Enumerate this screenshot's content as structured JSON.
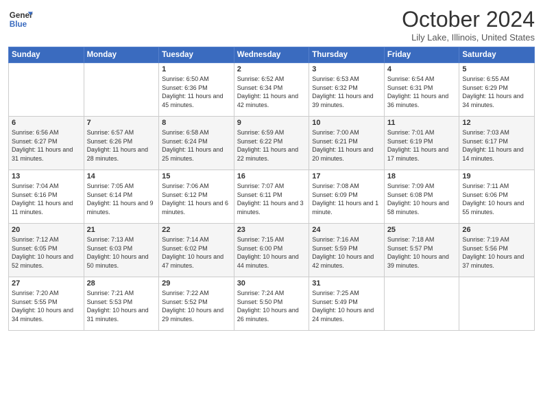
{
  "header": {
    "logo_line1": "General",
    "logo_line2": "Blue",
    "month_title": "October 2024",
    "location": "Lily Lake, Illinois, United States"
  },
  "days_of_week": [
    "Sunday",
    "Monday",
    "Tuesday",
    "Wednesday",
    "Thursday",
    "Friday",
    "Saturday"
  ],
  "weeks": [
    [
      {
        "day": "",
        "info": ""
      },
      {
        "day": "",
        "info": ""
      },
      {
        "day": "1",
        "info": "Sunrise: 6:50 AM\nSunset: 6:36 PM\nDaylight: 11 hours and 45 minutes."
      },
      {
        "day": "2",
        "info": "Sunrise: 6:52 AM\nSunset: 6:34 PM\nDaylight: 11 hours and 42 minutes."
      },
      {
        "day": "3",
        "info": "Sunrise: 6:53 AM\nSunset: 6:32 PM\nDaylight: 11 hours and 39 minutes."
      },
      {
        "day": "4",
        "info": "Sunrise: 6:54 AM\nSunset: 6:31 PM\nDaylight: 11 hours and 36 minutes."
      },
      {
        "day": "5",
        "info": "Sunrise: 6:55 AM\nSunset: 6:29 PM\nDaylight: 11 hours and 34 minutes."
      }
    ],
    [
      {
        "day": "6",
        "info": "Sunrise: 6:56 AM\nSunset: 6:27 PM\nDaylight: 11 hours and 31 minutes."
      },
      {
        "day": "7",
        "info": "Sunrise: 6:57 AM\nSunset: 6:26 PM\nDaylight: 11 hours and 28 minutes."
      },
      {
        "day": "8",
        "info": "Sunrise: 6:58 AM\nSunset: 6:24 PM\nDaylight: 11 hours and 25 minutes."
      },
      {
        "day": "9",
        "info": "Sunrise: 6:59 AM\nSunset: 6:22 PM\nDaylight: 11 hours and 22 minutes."
      },
      {
        "day": "10",
        "info": "Sunrise: 7:00 AM\nSunset: 6:21 PM\nDaylight: 11 hours and 20 minutes."
      },
      {
        "day": "11",
        "info": "Sunrise: 7:01 AM\nSunset: 6:19 PM\nDaylight: 11 hours and 17 minutes."
      },
      {
        "day": "12",
        "info": "Sunrise: 7:03 AM\nSunset: 6:17 PM\nDaylight: 11 hours and 14 minutes."
      }
    ],
    [
      {
        "day": "13",
        "info": "Sunrise: 7:04 AM\nSunset: 6:16 PM\nDaylight: 11 hours and 11 minutes."
      },
      {
        "day": "14",
        "info": "Sunrise: 7:05 AM\nSunset: 6:14 PM\nDaylight: 11 hours and 9 minutes."
      },
      {
        "day": "15",
        "info": "Sunrise: 7:06 AM\nSunset: 6:12 PM\nDaylight: 11 hours and 6 minutes."
      },
      {
        "day": "16",
        "info": "Sunrise: 7:07 AM\nSunset: 6:11 PM\nDaylight: 11 hours and 3 minutes."
      },
      {
        "day": "17",
        "info": "Sunrise: 7:08 AM\nSunset: 6:09 PM\nDaylight: 11 hours and 1 minute."
      },
      {
        "day": "18",
        "info": "Sunrise: 7:09 AM\nSunset: 6:08 PM\nDaylight: 10 hours and 58 minutes."
      },
      {
        "day": "19",
        "info": "Sunrise: 7:11 AM\nSunset: 6:06 PM\nDaylight: 10 hours and 55 minutes."
      }
    ],
    [
      {
        "day": "20",
        "info": "Sunrise: 7:12 AM\nSunset: 6:05 PM\nDaylight: 10 hours and 52 minutes."
      },
      {
        "day": "21",
        "info": "Sunrise: 7:13 AM\nSunset: 6:03 PM\nDaylight: 10 hours and 50 minutes."
      },
      {
        "day": "22",
        "info": "Sunrise: 7:14 AM\nSunset: 6:02 PM\nDaylight: 10 hours and 47 minutes."
      },
      {
        "day": "23",
        "info": "Sunrise: 7:15 AM\nSunset: 6:00 PM\nDaylight: 10 hours and 44 minutes."
      },
      {
        "day": "24",
        "info": "Sunrise: 7:16 AM\nSunset: 5:59 PM\nDaylight: 10 hours and 42 minutes."
      },
      {
        "day": "25",
        "info": "Sunrise: 7:18 AM\nSunset: 5:57 PM\nDaylight: 10 hours and 39 minutes."
      },
      {
        "day": "26",
        "info": "Sunrise: 7:19 AM\nSunset: 5:56 PM\nDaylight: 10 hours and 37 minutes."
      }
    ],
    [
      {
        "day": "27",
        "info": "Sunrise: 7:20 AM\nSunset: 5:55 PM\nDaylight: 10 hours and 34 minutes."
      },
      {
        "day": "28",
        "info": "Sunrise: 7:21 AM\nSunset: 5:53 PM\nDaylight: 10 hours and 31 minutes."
      },
      {
        "day": "29",
        "info": "Sunrise: 7:22 AM\nSunset: 5:52 PM\nDaylight: 10 hours and 29 minutes."
      },
      {
        "day": "30",
        "info": "Sunrise: 7:24 AM\nSunset: 5:50 PM\nDaylight: 10 hours and 26 minutes."
      },
      {
        "day": "31",
        "info": "Sunrise: 7:25 AM\nSunset: 5:49 PM\nDaylight: 10 hours and 24 minutes."
      },
      {
        "day": "",
        "info": ""
      },
      {
        "day": "",
        "info": ""
      }
    ]
  ]
}
